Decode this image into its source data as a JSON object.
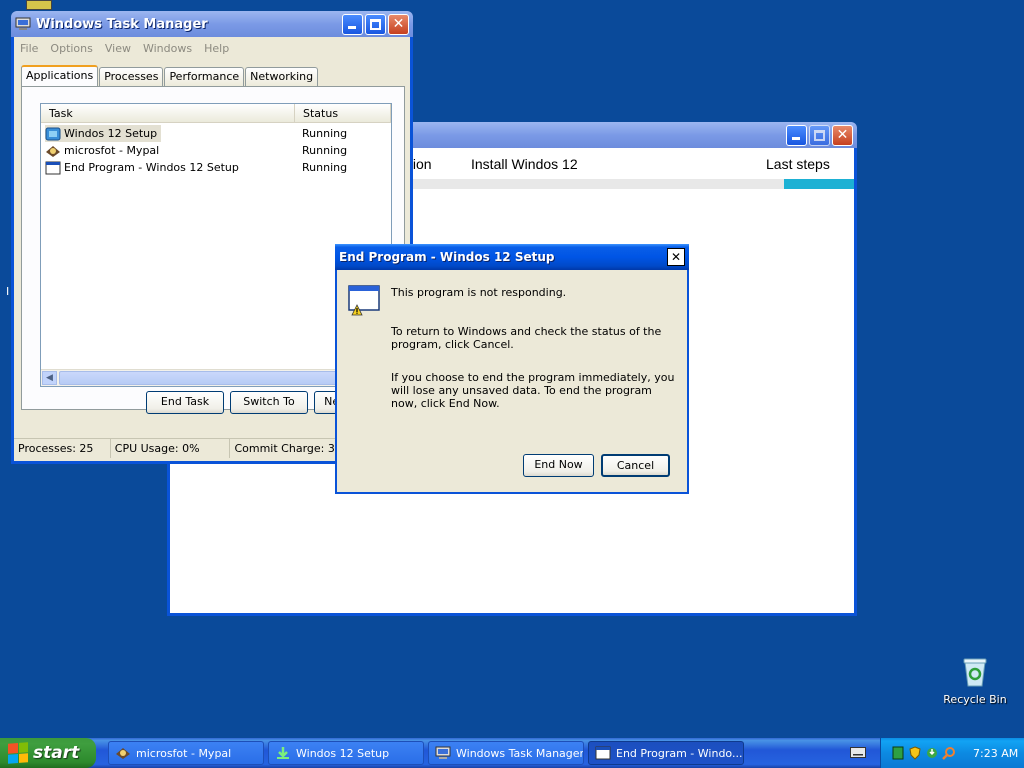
{
  "desktop": {
    "recycle_bin_label": "Recycle Bin",
    "cursor_glyph": "I"
  },
  "setup_window": {
    "steps": [
      "tion",
      "Install Windos 12",
      "Last steps"
    ],
    "progress_color": "#1db1d4"
  },
  "task_manager": {
    "title": "Windows Task Manager",
    "menu": [
      "File",
      "Options",
      "View",
      "Windows",
      "Help"
    ],
    "tabs": [
      "Applications",
      "Processes",
      "Performance",
      "Networking"
    ],
    "active_tab": "Applications",
    "columns": [
      "Task",
      "Status"
    ],
    "rows": [
      {
        "task": "Windos 12 Setup",
        "status": "Running",
        "icon": "setup-icon"
      },
      {
        "task": "microsfot - Mypal",
        "status": "Running",
        "icon": "mypal-icon"
      },
      {
        "task": "End Program - Windos 12 Setup",
        "status": "Running",
        "icon": "window-icon"
      }
    ],
    "buttons": {
      "end_task": "End Task",
      "switch_to": "Switch To",
      "new_task": "New Task..."
    },
    "status": {
      "processes": "Processes: 25",
      "cpu": "CPU Usage: 0%",
      "commit": "Commit Charge: 327M / 1247M"
    }
  },
  "dialog": {
    "title": "End Program - Windos 12 Setup",
    "close_label": "✕",
    "line1": "This program is not responding.",
    "line2": "To return to Windows and check the status of the program, click Cancel.",
    "line3": "If you choose to end the program immediately, you will lose any unsaved data. To end the program now, click End Now.",
    "end_now": "End Now",
    "cancel": "Cancel"
  },
  "taskbar": {
    "start_label": "start",
    "tasks": [
      {
        "label": "microsfot - Mypal",
        "icon": "mypal-icon",
        "active": false
      },
      {
        "label": "Windos 12 Setup",
        "icon": "setup-icon",
        "active": false
      },
      {
        "label": "Windows Task Manager",
        "icon": "taskmgr-icon",
        "active": false
      },
      {
        "label": "End Program - Windo...",
        "icon": "window-icon",
        "active": true
      }
    ],
    "clock": "7:23 AM"
  },
  "colors": {
    "desktop": "#0a4a9a",
    "titlebar": "#0055e5",
    "window_bg": "#ece9d8",
    "taskbar": "#2157d7",
    "start": "#3f9e3f"
  }
}
